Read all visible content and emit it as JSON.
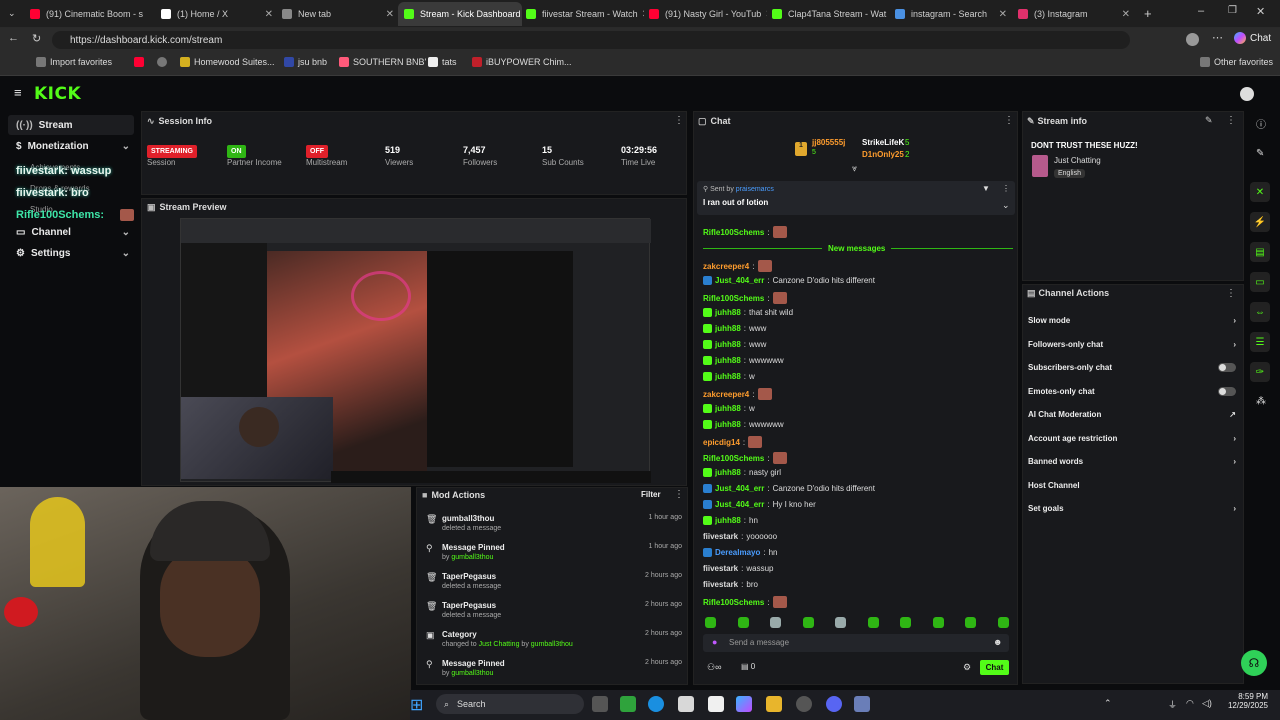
{
  "browser": {
    "tabs": [
      {
        "title": "(91) Cinematic Boom - s",
        "color": "#ff0033"
      },
      {
        "title": "(1) Home / X",
        "color": "#ffffff"
      },
      {
        "title": "New tab",
        "color": "#888888"
      },
      {
        "title": "Stream - Kick Dashboard",
        "color": "#53fc18"
      },
      {
        "title": "fiivestar Stream - Watch",
        "color": "#53fc18"
      },
      {
        "title": "(91) Nasty Girl - YouTub",
        "color": "#ff0033"
      },
      {
        "title": "Clap4Tana Stream - Wat",
        "color": "#53fc18"
      },
      {
        "title": "instagram - Search",
        "color": "#4a90e2"
      },
      {
        "title": "(3) Instagram",
        "color": "#e1306c"
      }
    ],
    "url": "https://dashboard.kick.com/stream",
    "bookmarks": [
      "Import favorites",
      "Homewood Suites...",
      "jsu bnb",
      "SOUTHERN BNB'",
      "tats",
      "iBUYPOWER Chim...",
      "Other favorites"
    ],
    "copilot": "Chat"
  },
  "nav": {
    "stream": "Stream",
    "monetization": "Monetization",
    "achievements": "Achievements",
    "drops": "Drops & rewards",
    "studio": "Studio",
    "channel": "Channel",
    "settings": "Settings",
    "overlay_lines": [
      "fiivestark: wassup",
      "fiivestark: bro",
      "Rifle100Schems:"
    ]
  },
  "session": {
    "title": "Session Info",
    "stats": [
      {
        "pill": "STREAMING",
        "pill_color": "#e0202a",
        "label": "Session"
      },
      {
        "pill": "ON",
        "pill_color": "#2fb614",
        "label": "Partner Income"
      },
      {
        "pill": "OFF",
        "pill_color": "#e0202a",
        "label": "Multistream"
      },
      {
        "value": "519",
        "label": "Viewers"
      },
      {
        "value": "7,457",
        "label": "Followers"
      },
      {
        "value": "15",
        "label": "Sub Counts"
      },
      {
        "value": "03:29:56",
        "label": "Time Live"
      }
    ]
  },
  "preview": {
    "title": "Stream Preview"
  },
  "mod": {
    "title": "Mod Actions",
    "filter": "Filter",
    "items": [
      {
        "title": "gumball3thou",
        "sub": "deleted a message",
        "time": "1 hour ago",
        "icon": "trash-icon"
      },
      {
        "title": "Message Pinned",
        "sub_prefix": "by",
        "sub_user": "gumball3thou",
        "time": "1 hour ago",
        "icon": "pin-icon"
      },
      {
        "title": "TaperPegasus",
        "sub": "deleted a message",
        "time": "2 hours ago",
        "icon": "trash-icon"
      },
      {
        "title": "TaperPegasus",
        "sub": "deleted a message",
        "time": "2 hours ago",
        "icon": "trash-icon"
      },
      {
        "title": "Category",
        "sub_prefix": "changed to",
        "sub_user": "Just Chatting",
        "sub_mid": "by",
        "sub_user2": "gumball3thou",
        "time": "2 hours ago",
        "icon": "category-icon"
      },
      {
        "title": "Message Pinned",
        "sub_prefix": "by",
        "sub_user": "gumball3thou",
        "time": "2 hours ago",
        "icon": "pin-icon"
      }
    ]
  },
  "chat": {
    "title": "Chat",
    "gifters": [
      {
        "name": "jj805555j",
        "count": "5"
      },
      {
        "name": "StrikeLifeK",
        "count": "5"
      },
      {
        "name": "D1nOnly25",
        "count": "2"
      }
    ],
    "pinned": {
      "sent_by_label": "Sent by",
      "sent_by": "praisemarcs",
      "text": "I ran out of lotion"
    },
    "new_messages": "New messages",
    "messages": [
      {
        "user": "Rifle100Schems",
        "color": "#53fc18",
        "text": "",
        "emote": true
      },
      {
        "user": "zakcreeper4",
        "color": "#ff9d2e",
        "text": "",
        "emote": true
      },
      {
        "user": "Just_404_err",
        "color": "#53fc18",
        "text": "Canzone D'odio hits different",
        "emote": false
      },
      {
        "user": "Rifle100Schems",
        "color": "#53fc18",
        "text": "",
        "emote": true
      },
      {
        "user": "juhh88",
        "color": "#53fc18",
        "text": "that shit wild",
        "emote": false
      },
      {
        "user": "juhh88",
        "color": "#53fc18",
        "text": "www",
        "emote": false
      },
      {
        "user": "juhh88",
        "color": "#53fc18",
        "text": "www",
        "emote": false
      },
      {
        "user": "juhh88",
        "color": "#53fc18",
        "text": "wwwwww",
        "emote": false
      },
      {
        "user": "juhh88",
        "color": "#53fc18",
        "text": "w",
        "emote": false
      },
      {
        "user": "zakcreeper4",
        "color": "#ff9d2e",
        "text": "",
        "emote": true
      },
      {
        "user": "juhh88",
        "color": "#53fc18",
        "text": "w",
        "emote": false
      },
      {
        "user": "juhh88",
        "color": "#53fc18",
        "text": "wwwwww",
        "emote": false
      },
      {
        "user": "epicdig14",
        "color": "#ff9d2e",
        "text": "",
        "emote": true
      },
      {
        "user": "Rifle100Schems",
        "color": "#53fc18",
        "text": "",
        "emote": true
      },
      {
        "user": "juhh88",
        "color": "#53fc18",
        "text": "nasty girl",
        "emote": false
      },
      {
        "user": "Just_404_err",
        "color": "#53fc18",
        "text": "Canzone D'odio hits different",
        "emote": false
      },
      {
        "user": "Just_404_err",
        "color": "#53fc18",
        "text": "Hy I kno her",
        "emote": false
      },
      {
        "user": "juhh88",
        "color": "#53fc18",
        "text": "hn",
        "emote": false
      },
      {
        "user": "fiivestark",
        "color": "#dddddd",
        "text": "yoooooo",
        "emote": false
      },
      {
        "user": "Derealmayo",
        "color": "#4a9dff",
        "text": "hn",
        "emote": false
      },
      {
        "user": "fiivestark",
        "color": "#dddddd",
        "text": "wassup",
        "emote": false
      },
      {
        "user": "fiivestark",
        "color": "#dddddd",
        "text": "bro",
        "emote": false
      },
      {
        "user": "Rifle100Schems",
        "color": "#53fc18",
        "text": "",
        "emote": true
      }
    ],
    "input_placeholder": "Send a message",
    "points": "0",
    "send": "Chat"
  },
  "stream_info": {
    "title": "Stream info",
    "stream_title": "DONT TRUST THESE HUZZ!",
    "category": "Just Chatting",
    "language": "English"
  },
  "channel_actions": {
    "title": "Channel Actions",
    "items": [
      {
        "label": "Slow mode",
        "kind": "chevron"
      },
      {
        "label": "Followers-only chat",
        "kind": "chevron"
      },
      {
        "label": "Subscribers-only chat",
        "kind": "toggle"
      },
      {
        "label": "Emotes-only chat",
        "kind": "toggle"
      },
      {
        "label": "AI Chat Moderation",
        "kind": "external"
      },
      {
        "label": "Account age restriction",
        "kind": "chevron"
      },
      {
        "label": "Banned words",
        "kind": "chevron"
      },
      {
        "label": "Host Channel",
        "kind": "none"
      },
      {
        "label": "Set goals",
        "kind": "chevron"
      }
    ]
  },
  "taskbar": {
    "search": "Search",
    "time": "8:59 PM",
    "date": "12/29/2025"
  }
}
